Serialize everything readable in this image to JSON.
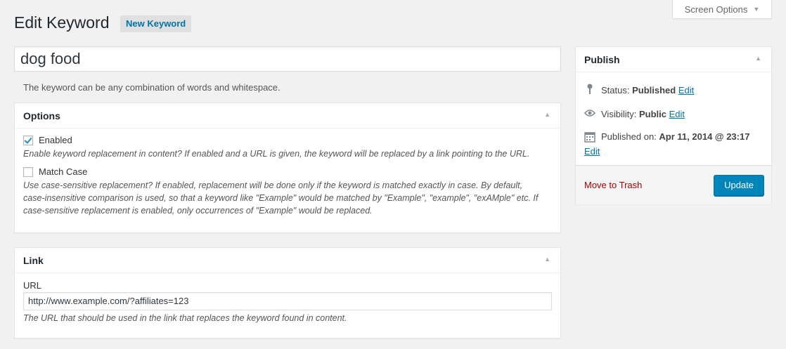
{
  "screen_options": {
    "label": "Screen Options"
  },
  "page": {
    "title": "Edit Keyword",
    "add_new": "New Keyword"
  },
  "keyword": {
    "value": "dog food",
    "description": "The keyword can be any combination of words and whitespace."
  },
  "options_box": {
    "title": "Options",
    "enabled": {
      "label": "Enabled",
      "checked": true,
      "hint": "Enable keyword replacement in content? If enabled and a URL is given, the keyword will be replaced by a link pointing to the URL."
    },
    "match_case": {
      "label": "Match Case",
      "checked": false,
      "hint_lines": [
        "Use case-sensitive replacement? If enabled, replacement will be done only if the keyword is matched exactly in case. By default,",
        "case-insensitive comparison is used, so that a keyword like \"Example\" would be matched by \"Example\", \"example\", \"exAMple\" etc. If",
        "case-sensitive replacement is enabled, only occurrences of \"Example\" would be replaced."
      ]
    }
  },
  "link_box": {
    "title": "Link",
    "url_label": "URL",
    "url_value": "http://www.example.com/?affiliates=123",
    "hint": "The URL that should be used in the link that replaces the keyword found in content."
  },
  "publish_box": {
    "title": "Publish",
    "status_label": "Status:",
    "status_value": "Published",
    "status_edit": "Edit",
    "visibility_label": "Visibility:",
    "visibility_value": "Public",
    "visibility_edit": "Edit",
    "published_label": "Published on:",
    "published_value": "Apr 11, 2014 @ 23:17",
    "published_edit": "Edit",
    "trash": "Move to Trash",
    "update": "Update"
  },
  "icons": {
    "pin": "pin-icon",
    "eye": "eye-icon",
    "calendar": "calendar-icon",
    "caret": "caret-up-icon"
  },
  "colors": {
    "accent": "#0085ba",
    "link": "#0073aa",
    "trash": "#aa0000"
  }
}
